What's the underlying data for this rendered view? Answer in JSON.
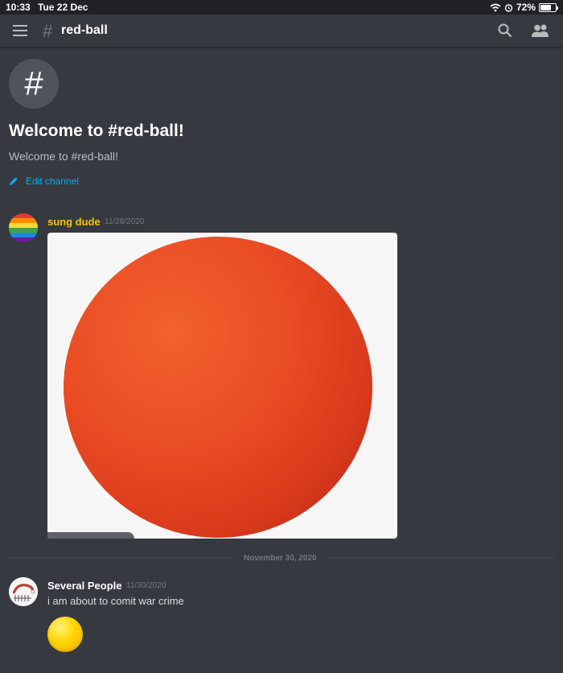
{
  "status_bar": {
    "time": "10:33",
    "date": "Tue 22 Dec",
    "battery": "72%",
    "icons": [
      "wifi-icon",
      "alarm-icon",
      "battery-icon"
    ]
  },
  "header": {
    "hash": "#",
    "channel": "red-ball",
    "icons": [
      "menu-icon",
      "search-icon",
      "members-icon"
    ]
  },
  "welcome": {
    "icon_glyph": "#",
    "title": "Welcome to #red-ball!",
    "subtitle": "Welcome to #red-ball!",
    "edit_label": "Edit channel"
  },
  "messages": [
    {
      "author": "sung dude",
      "author_color": "#f1c40f",
      "timestamp": "11/28/2020",
      "attachment": "red-ball-image"
    },
    {
      "author": "Several People",
      "author_color": "#ffffff",
      "timestamp": "11/30/2020",
      "text": "i am about to comit war crime",
      "emoji": "yellow-circle"
    }
  ],
  "date_divider": "November 30, 2020",
  "colors": {
    "background": "#36393f",
    "accent": "#00b0f4",
    "ball": "#e94b22"
  }
}
